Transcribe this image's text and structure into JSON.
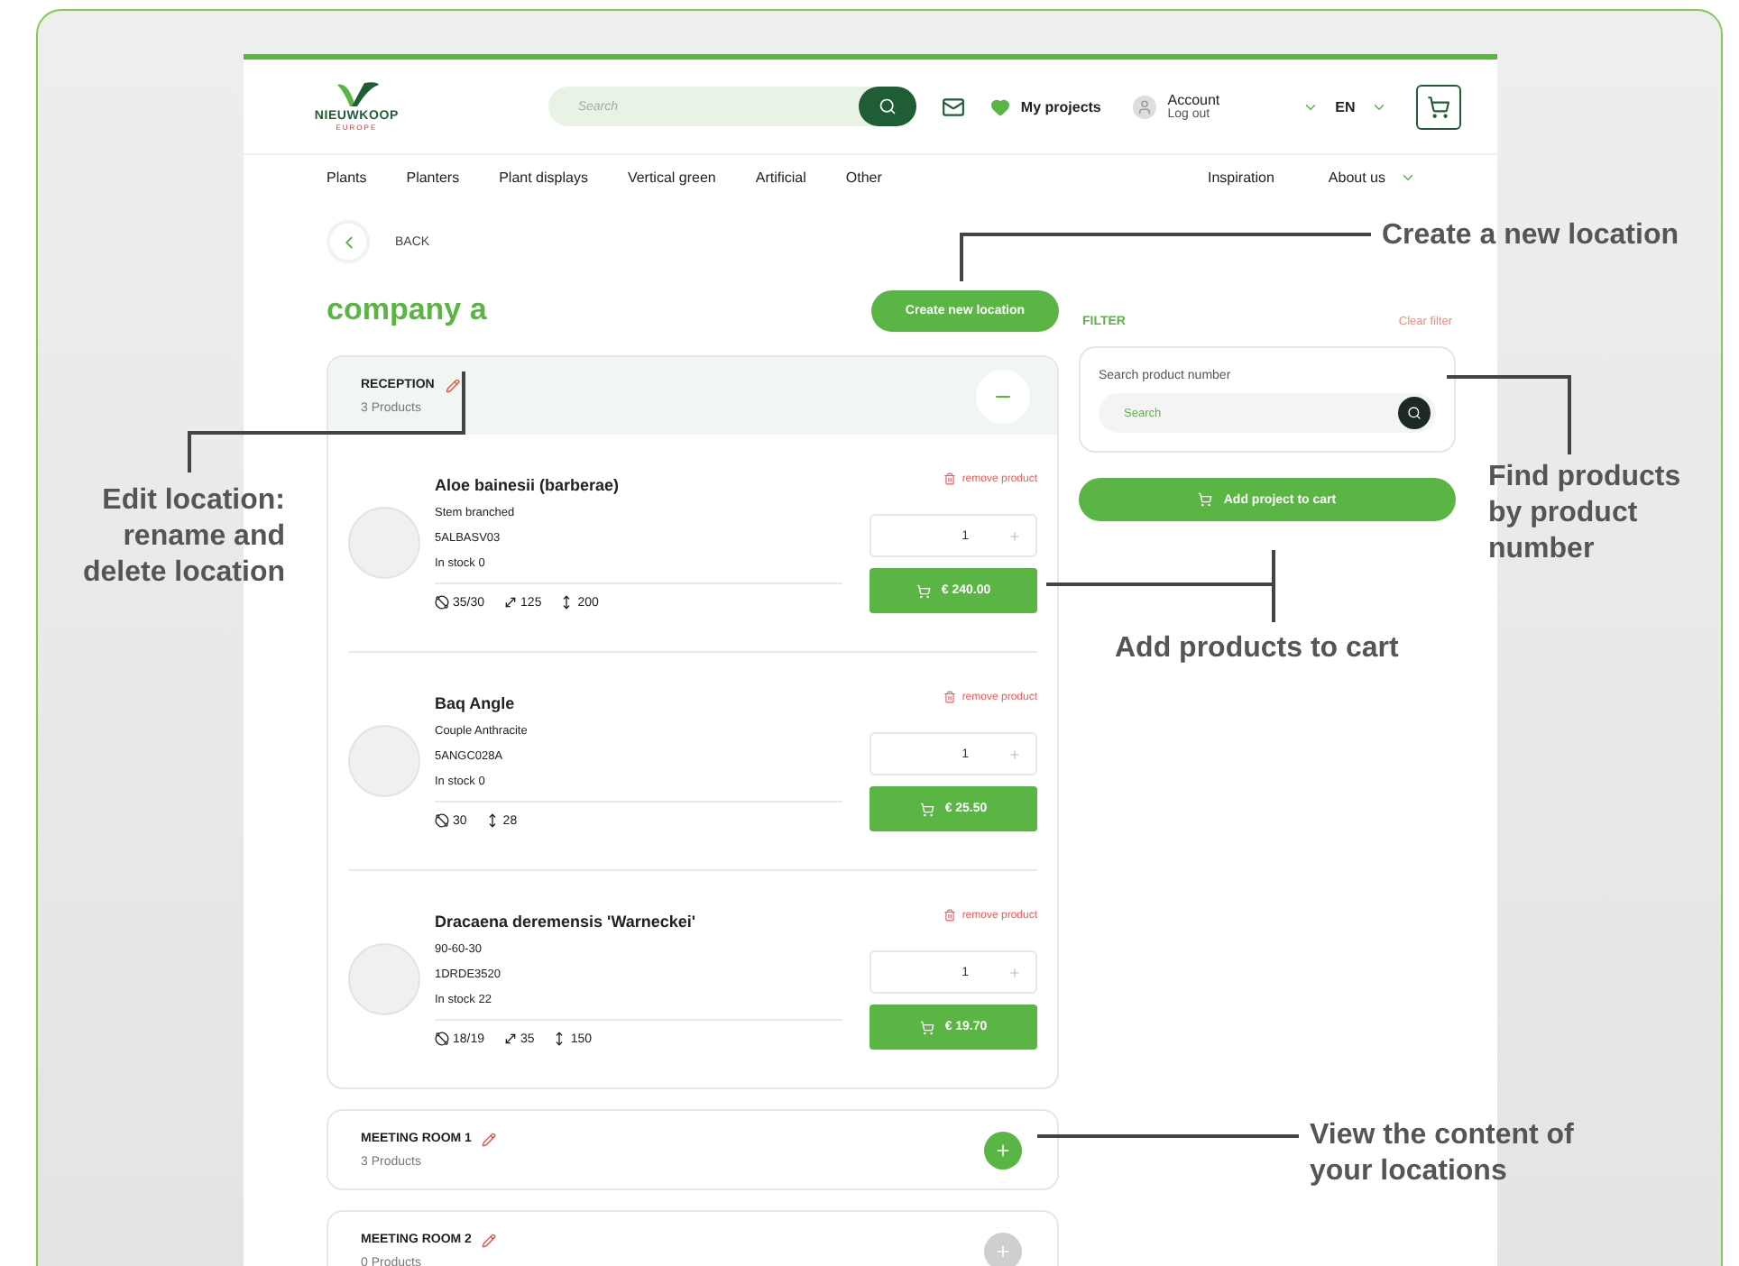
{
  "header": {
    "logo": {
      "name": "NIEUWKOOP",
      "region": "EUROPE"
    },
    "search": {
      "placeholder": "Search"
    },
    "projects": "My projects",
    "account": {
      "title": "Account",
      "action": "Log out"
    },
    "language": "EN"
  },
  "nav": {
    "left": [
      {
        "label": "Plants",
        "dropdown": false
      },
      {
        "label": "Planters",
        "dropdown": false
      },
      {
        "label": "Plant displays",
        "dropdown": false
      },
      {
        "label": "Vertical green",
        "dropdown": false
      },
      {
        "label": "Artificial",
        "dropdown": false
      },
      {
        "label": "Other",
        "dropdown": false
      }
    ],
    "right": [
      {
        "label": "Inspiration",
        "dropdown": false
      },
      {
        "label": "About us",
        "dropdown": true
      }
    ]
  },
  "back": "BACK",
  "title": "company a",
  "create_button": "Create new location",
  "locations": [
    {
      "name": "RECEPTION",
      "count": "3 Products",
      "expanded": true,
      "disabled": false,
      "products": [
        {
          "name": "Aloe bainesii (barberae)",
          "variant": "Stem branched",
          "code": "5ALBASV03",
          "stock": "In stock 0",
          "specs": [
            {
              "kind": "diameter",
              "value": "35/30"
            },
            {
              "kind": "length",
              "value": "125"
            },
            {
              "kind": "height",
              "value": "200"
            }
          ],
          "remove": "remove product",
          "quantity": "1",
          "price": "€ 240.00"
        },
        {
          "name": "Baq Angle",
          "variant": "Couple Anthracite",
          "code": "5ANGC028A",
          "stock": "In stock 0",
          "specs": [
            {
              "kind": "diameter",
              "value": "30"
            },
            {
              "kind": "height",
              "value": "28"
            }
          ],
          "remove": "remove product",
          "quantity": "1",
          "price": "€ 25.50"
        },
        {
          "name": "Dracaena deremensis 'Warneckei'",
          "variant": "90-60-30",
          "code": "1DRDE3520",
          "stock": "In stock 22",
          "specs": [
            {
              "kind": "diameter",
              "value": "18/19"
            },
            {
              "kind": "length",
              "value": "35"
            },
            {
              "kind": "height",
              "value": "150"
            }
          ],
          "remove": "remove product",
          "quantity": "1",
          "price": "€ 19.70"
        }
      ]
    },
    {
      "name": "MEETING ROOM 1",
      "count": "3 Products",
      "expanded": false,
      "disabled": false
    },
    {
      "name": "MEETING ROOM 2",
      "count": "0 Products",
      "expanded": false,
      "disabled": true
    }
  ],
  "filter": {
    "title": "FILTER",
    "clear": "Clear filter",
    "label": "Search product number",
    "placeholder": "Search",
    "add_button": "Add project to cart"
  },
  "annotations": [
    {
      "text": "Create a new location"
    },
    {
      "text": "Find products by product number"
    },
    {
      "text": "Add products to cart"
    },
    {
      "text": "View the content of your locations"
    },
    {
      "text": "Edit location: rename and delete location"
    }
  ]
}
